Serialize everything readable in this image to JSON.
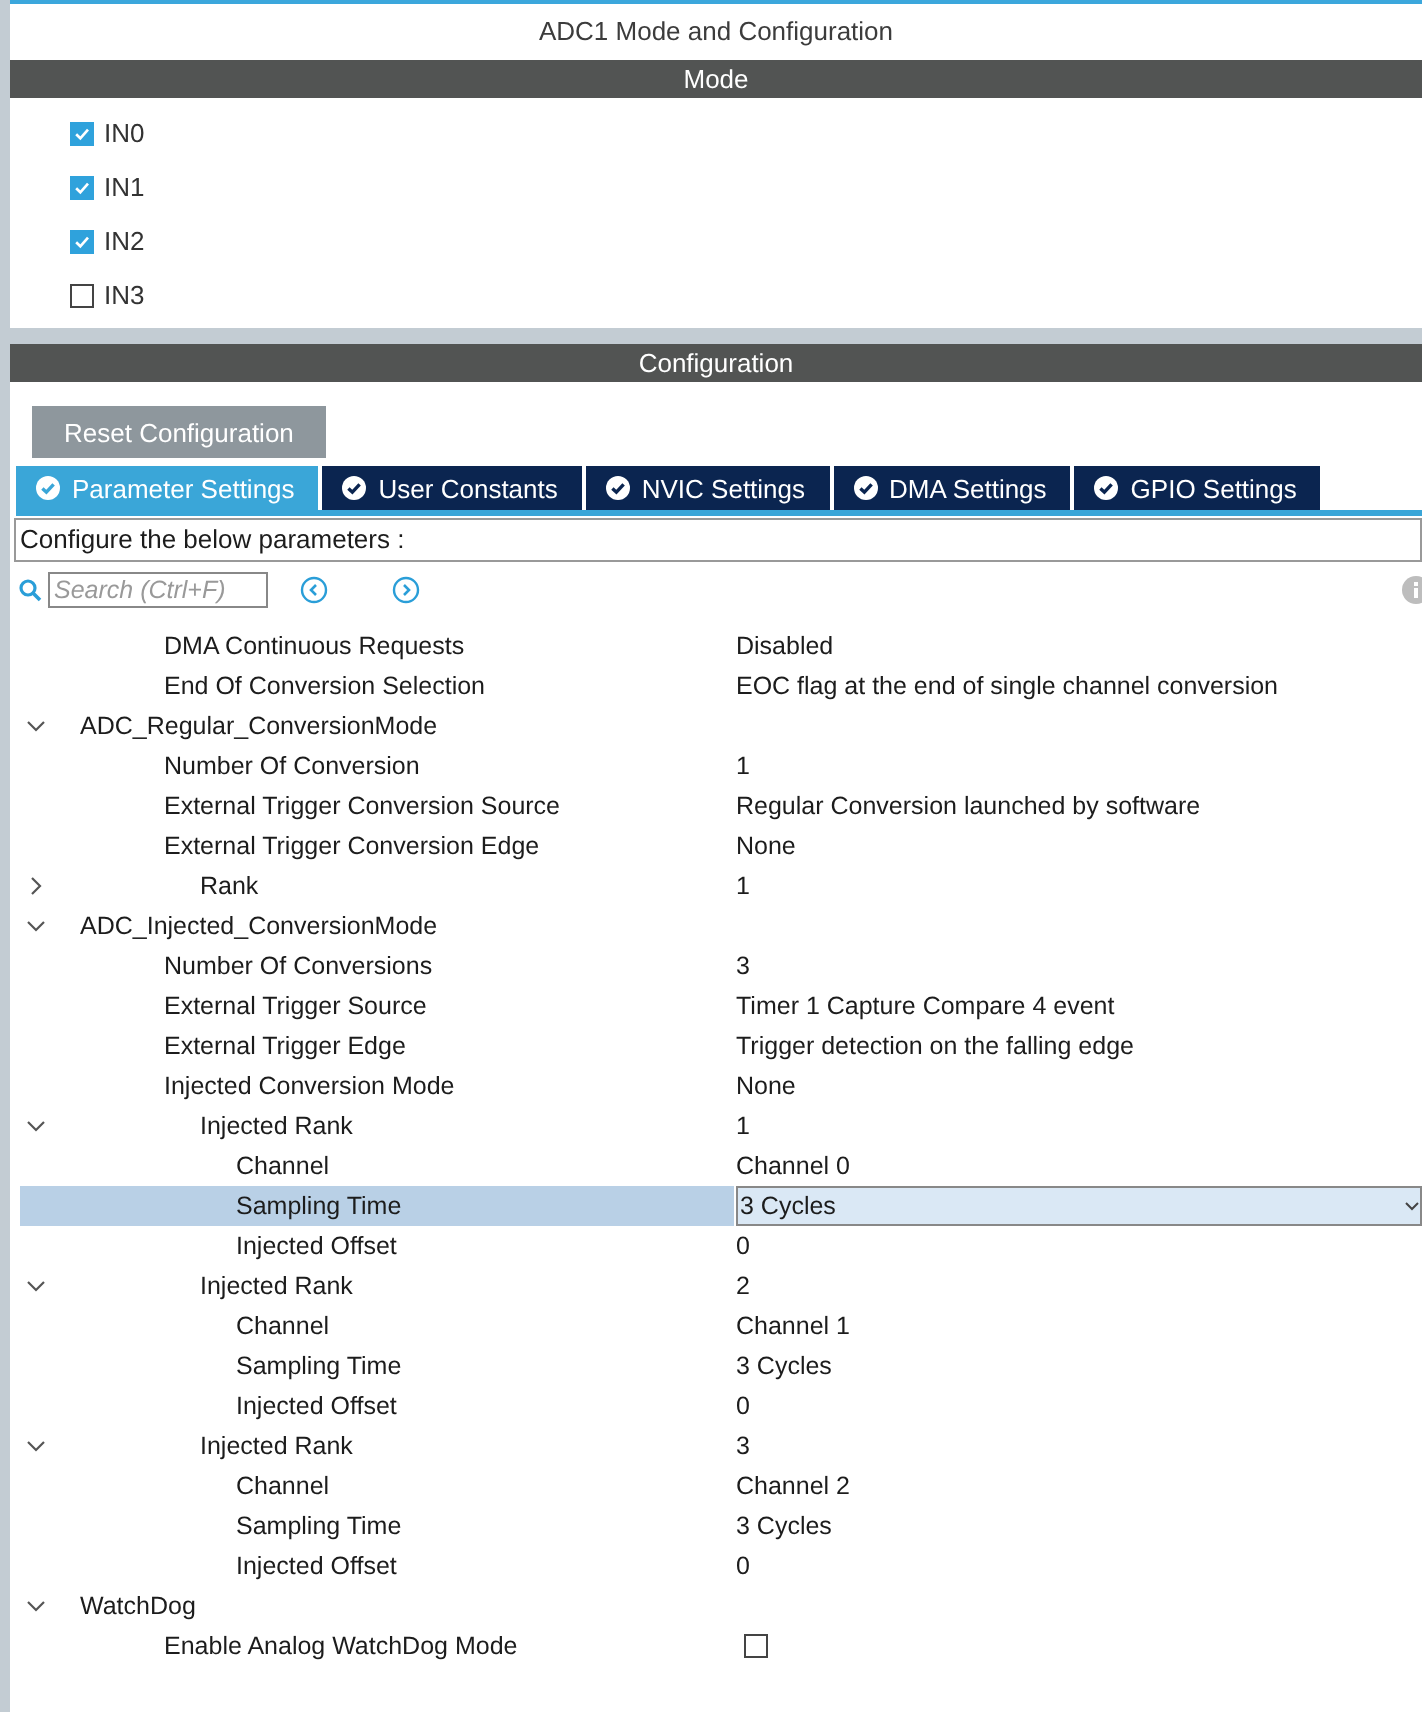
{
  "window": {
    "title": "ADC1 Mode and Configuration"
  },
  "mode": {
    "header": "Mode",
    "channels": [
      {
        "label": "IN0",
        "checked": true
      },
      {
        "label": "IN1",
        "checked": true
      },
      {
        "label": "IN2",
        "checked": true
      },
      {
        "label": "IN3",
        "checked": false
      }
    ]
  },
  "configuration": {
    "header": "Configuration",
    "reset_button": "Reset Configuration",
    "tabs": [
      {
        "label": "Parameter Settings",
        "selected": true
      },
      {
        "label": "User Constants",
        "selected": false
      },
      {
        "label": "NVIC Settings",
        "selected": false
      },
      {
        "label": "DMA Settings",
        "selected": false
      },
      {
        "label": "GPIO Settings",
        "selected": false
      }
    ],
    "hint": "Configure the below parameters :",
    "search": {
      "placeholder": "Search (Ctrl+F)"
    },
    "tree": [
      {
        "children": [
          {
            "label": "DMA Continuous Requests",
            "value": "Disabled",
            "selected": false
          },
          {
            "label": "End Of Conversion Selection",
            "value": "EOC flag at the end of single channel conversion",
            "selected": false
          }
        ]
      },
      {
        "label": "ADC_Regular_ConversionMode",
        "expanded": true,
        "children": [
          {
            "label": "Number Of Conversion",
            "value": "1",
            "selected": false
          },
          {
            "label": "External Trigger Conversion Source",
            "value": "Regular Conversion launched by software",
            "selected": false
          },
          {
            "label": "External Trigger Conversion Edge",
            "value": "None",
            "selected": false
          },
          {
            "label": "Rank",
            "value": "1",
            "expanded": false
          }
        ]
      },
      {
        "label": "ADC_Injected_ConversionMode",
        "expanded": true,
        "children": [
          {
            "label": "Number Of Conversions",
            "value": "3",
            "selected": false
          },
          {
            "label": "External Trigger Source",
            "value": "Timer 1 Capture Compare 4 event",
            "selected": false
          },
          {
            "label": "External Trigger Edge",
            "value": "Trigger detection on the falling edge",
            "selected": false
          },
          {
            "label": "Injected Conversion Mode",
            "value": "None",
            "selected": false
          },
          {
            "label": "Injected Rank",
            "value": "1",
            "expanded": true,
            "children": [
              {
                "label": "Channel",
                "value": "Channel 0",
                "selected": false
              },
              {
                "label": "Sampling Time",
                "value": "3 Cycles",
                "selected": true
              },
              {
                "label": "Injected Offset",
                "value": "0",
                "selected": false
              }
            ]
          },
          {
            "label": "Injected Rank",
            "value": "2",
            "expanded": true,
            "children": [
              {
                "label": "Channel",
                "value": "Channel 1",
                "selected": false
              },
              {
                "label": "Sampling Time",
                "value": "3 Cycles",
                "selected": false
              },
              {
                "label": "Injected Offset",
                "value": "0",
                "selected": false
              }
            ]
          },
          {
            "label": "Injected Rank",
            "value": "3",
            "expanded": true,
            "children": [
              {
                "label": "Channel",
                "value": "Channel 2",
                "selected": false
              },
              {
                "label": "Sampling Time",
                "value": "3 Cycles",
                "selected": false
              },
              {
                "label": "Injected Offset",
                "value": "0",
                "selected": false
              }
            ]
          }
        ]
      },
      {
        "label": "WatchDog",
        "expanded": true,
        "children": [
          {
            "kind": "checkbox",
            "label": "Enable Analog WatchDog Mode",
            "checked": false,
            "selected": false
          }
        ]
      }
    ]
  }
}
